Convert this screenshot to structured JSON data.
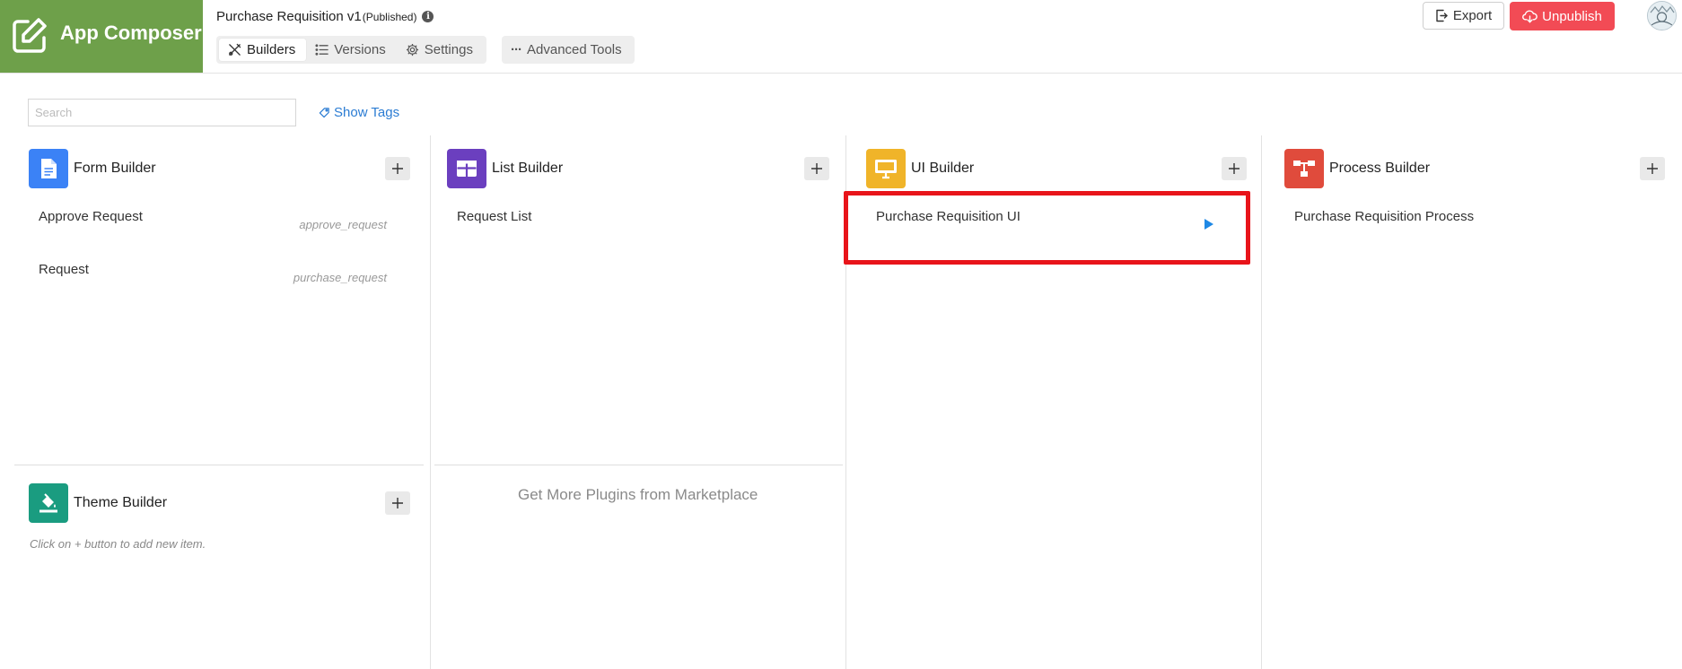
{
  "header": {
    "brand_title": "App Composer",
    "app_title": "Purchase Requisition v1",
    "app_status": "(Published)",
    "tabs": [
      {
        "label": "Builders",
        "icon": "tools-icon",
        "active": true
      },
      {
        "label": "Versions",
        "icon": "list-icon",
        "active": false
      },
      {
        "label": "Settings",
        "icon": "gear-icon",
        "active": false
      }
    ],
    "advanced_tools_label": "Advanced Tools",
    "export_label": "Export",
    "unpublish_label": "Unpublish"
  },
  "toolbar": {
    "search_placeholder": "Search",
    "show_tags_label": "Show Tags"
  },
  "builders": {
    "form": {
      "title": "Form Builder",
      "icon": "document-icon",
      "color": "#3b82f6",
      "items": [
        {
          "name": "Approve Request",
          "key": "approve_request"
        },
        {
          "name": "Request",
          "key": "purchase_request"
        }
      ]
    },
    "list": {
      "title": "List Builder",
      "icon": "table-icon",
      "color": "#6b3fbf",
      "items": [
        {
          "name": "Request List"
        }
      ]
    },
    "ui": {
      "title": "UI Builder",
      "icon": "monitor-icon",
      "color": "#f0b429",
      "items": [
        {
          "name": "Purchase Requisition UI"
        }
      ]
    },
    "process": {
      "title": "Process Builder",
      "icon": "flow-icon",
      "color": "#e04b3c",
      "items": [
        {
          "name": "Purchase Requisition Process"
        }
      ]
    },
    "theme": {
      "title": "Theme Builder",
      "icon": "paint-bucket-icon",
      "color": "#1a9c80",
      "hint_prefix": "Click on",
      "hint_symbol": "+",
      "hint_suffix": "button to add new item."
    }
  },
  "marketplace_label": "Get More Plugins from Marketplace",
  "colors": {
    "brand": "#6ea04a",
    "unpublish": "#f24b55",
    "link": "#2b7cd3",
    "highlight": "#e8141a",
    "play": "#1e88e5"
  }
}
